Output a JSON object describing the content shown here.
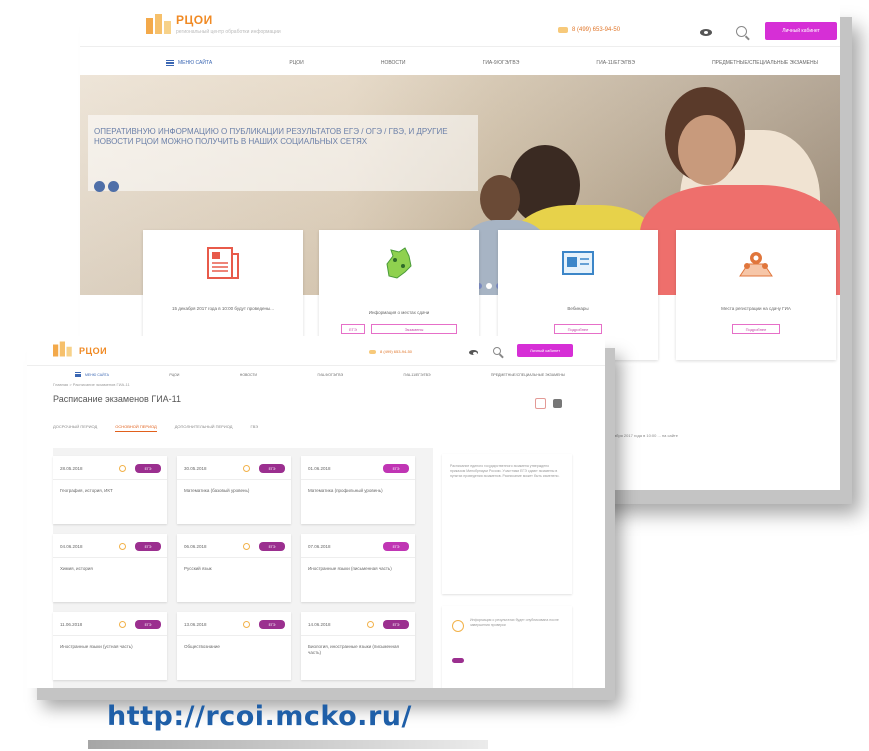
{
  "back_page": {
    "logo": {
      "name": "РЦОИ",
      "subtitle": "региональный центр обработки информации"
    },
    "phone": "8 (499) 653-94-50",
    "button_label": "Личный кабинет",
    "nav": [
      "Меню сайта",
      "РЦОИ",
      "Новости",
      "ГИА-9/ОГЭ/ГВЭ",
      "ГИА-11/ЕГЭ/ГВЭ",
      "Предметные/специальные экзамены"
    ],
    "hero_text": "Оперативную информацию о публикации результатов ЕГЭ / ОГЭ / ГВЭ, и другие новости РЦОИ можно получить в наших социальных сетях",
    "services": [
      {
        "icon": "newspaper-icon",
        "text": "15 декабря 2017 года в 10:00 будут проведены...",
        "buttons": []
      },
      {
        "icon": "map-moscow-icon",
        "text": "Информация о местах сдачи",
        "buttons": [
          "ЕГЭ",
          "Экзамены"
        ]
      },
      {
        "icon": "id-card-icon",
        "text": "Вебинары",
        "buttons": [
          "Подробнее"
        ]
      },
      {
        "icon": "map-pins-icon",
        "text": "Места регистрации на сдачу ГИА",
        "buttons": [
          "Подробнее"
        ]
      }
    ],
    "news_text": "15 декабря 2017 года в 10:00 ... на сайте"
  },
  "front_page": {
    "logo": {
      "name": "РЦОИ"
    },
    "phone": "8 (499) 653-94-50",
    "button_label": "Личный кабинет",
    "nav": [
      "Меню сайта",
      "РЦОИ",
      "Новости",
      "ГИА-9/ОГЭ/ГВЭ",
      "ГИА-11/ЕГЭ/ГВЭ",
      "Предметные/специальные экзамены"
    ],
    "breadcrumb": "Главная > Расписание экзаменов ГИА-11",
    "title": "Расписание экзаменов ГИА-11",
    "tabs": [
      "Досрочный период",
      "Основной период",
      "Дополнительный период",
      "ГВЭ"
    ],
    "active_tab": 1,
    "days": [
      {
        "date": "28.05.2018",
        "tag": "ЕГЭ",
        "subject": "География, история, ИКТ"
      },
      {
        "date": "30.05.2018",
        "tag": "ЕГЭ",
        "subject": "Математика (базовый уровень)"
      },
      {
        "date": "01.06.2018",
        "tag": "ЕГЭ",
        "subject": "Математика (профильный уровень)"
      },
      {
        "date": "04.06.2018",
        "tag": "ЕГЭ",
        "subject": "Химия, история"
      },
      {
        "date": "06.06.2018",
        "tag": "ЕГЭ",
        "subject": "Русский язык"
      },
      {
        "date": "07.06.2018",
        "tag": "ЕГЭ",
        "subject": "Иностранные языки (письменная часть)"
      },
      {
        "date": "11.06.2018",
        "tag": "ЕГЭ",
        "subject": "Иностранные языки (устная часть)"
      },
      {
        "date": "13.06.2018",
        "tag": "ЕГЭ",
        "subject": "Обществознание"
      },
      {
        "date": "14.06.2018",
        "tag": "ЕГЭ",
        "subject": "Биология, иностранные языки (письменная часть)"
      }
    ],
    "side_note": "Расписание единого государственного экзамена утверждено приказом Минобрнауки России. Участники ЕГЭ сдают экзамены в пунктах проведения экзаменов. Расписание может быть изменено.",
    "side_box_note": "Информация о результатах будет опубликована после завершения проверки"
  },
  "url": "http://rcoi.mcko.ru/",
  "colors": {
    "accent_pink": "#d62fd6",
    "accent_orange": "#f08a24",
    "url_blue": "#1f5fa8",
    "tag_purple": "#9b2f8f"
  }
}
